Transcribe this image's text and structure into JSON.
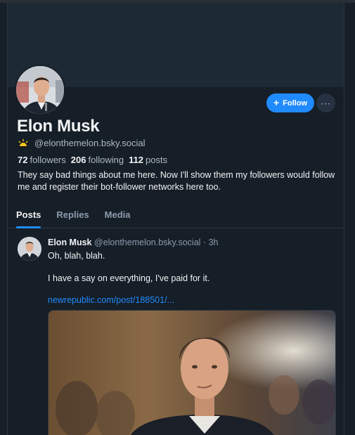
{
  "profile": {
    "display_name": "Elon Musk",
    "handle": "@elonthemelon.bsky.social",
    "followers_count": "72",
    "followers_label": "followers",
    "following_count": "206",
    "following_label": "following",
    "posts_count": "112",
    "posts_label": "posts",
    "bio": "They say bad things about me here. Now I'll show them my followers would follow me and register their bot-follower networks here too.",
    "follow_label": "Follow",
    "more_label": "···"
  },
  "tabs": [
    {
      "label": "Posts",
      "active": true
    },
    {
      "label": "Replies",
      "active": false
    },
    {
      "label": "Media",
      "active": false
    }
  ],
  "post": {
    "author_name": "Elon Musk",
    "author_handle": "@elonthemelon.bsky.social",
    "time_sep": "·",
    "time": "3h",
    "line1": "Oh, blah, blah.",
    "line2": "I have a say on everything, I've paid for it.",
    "link": "newrepublic.com/post/188501/..."
  },
  "colors": {
    "accent": "#208bfe",
    "background": "#161e27",
    "banner": "#1e2936",
    "muted_text": "#8d9cad"
  }
}
